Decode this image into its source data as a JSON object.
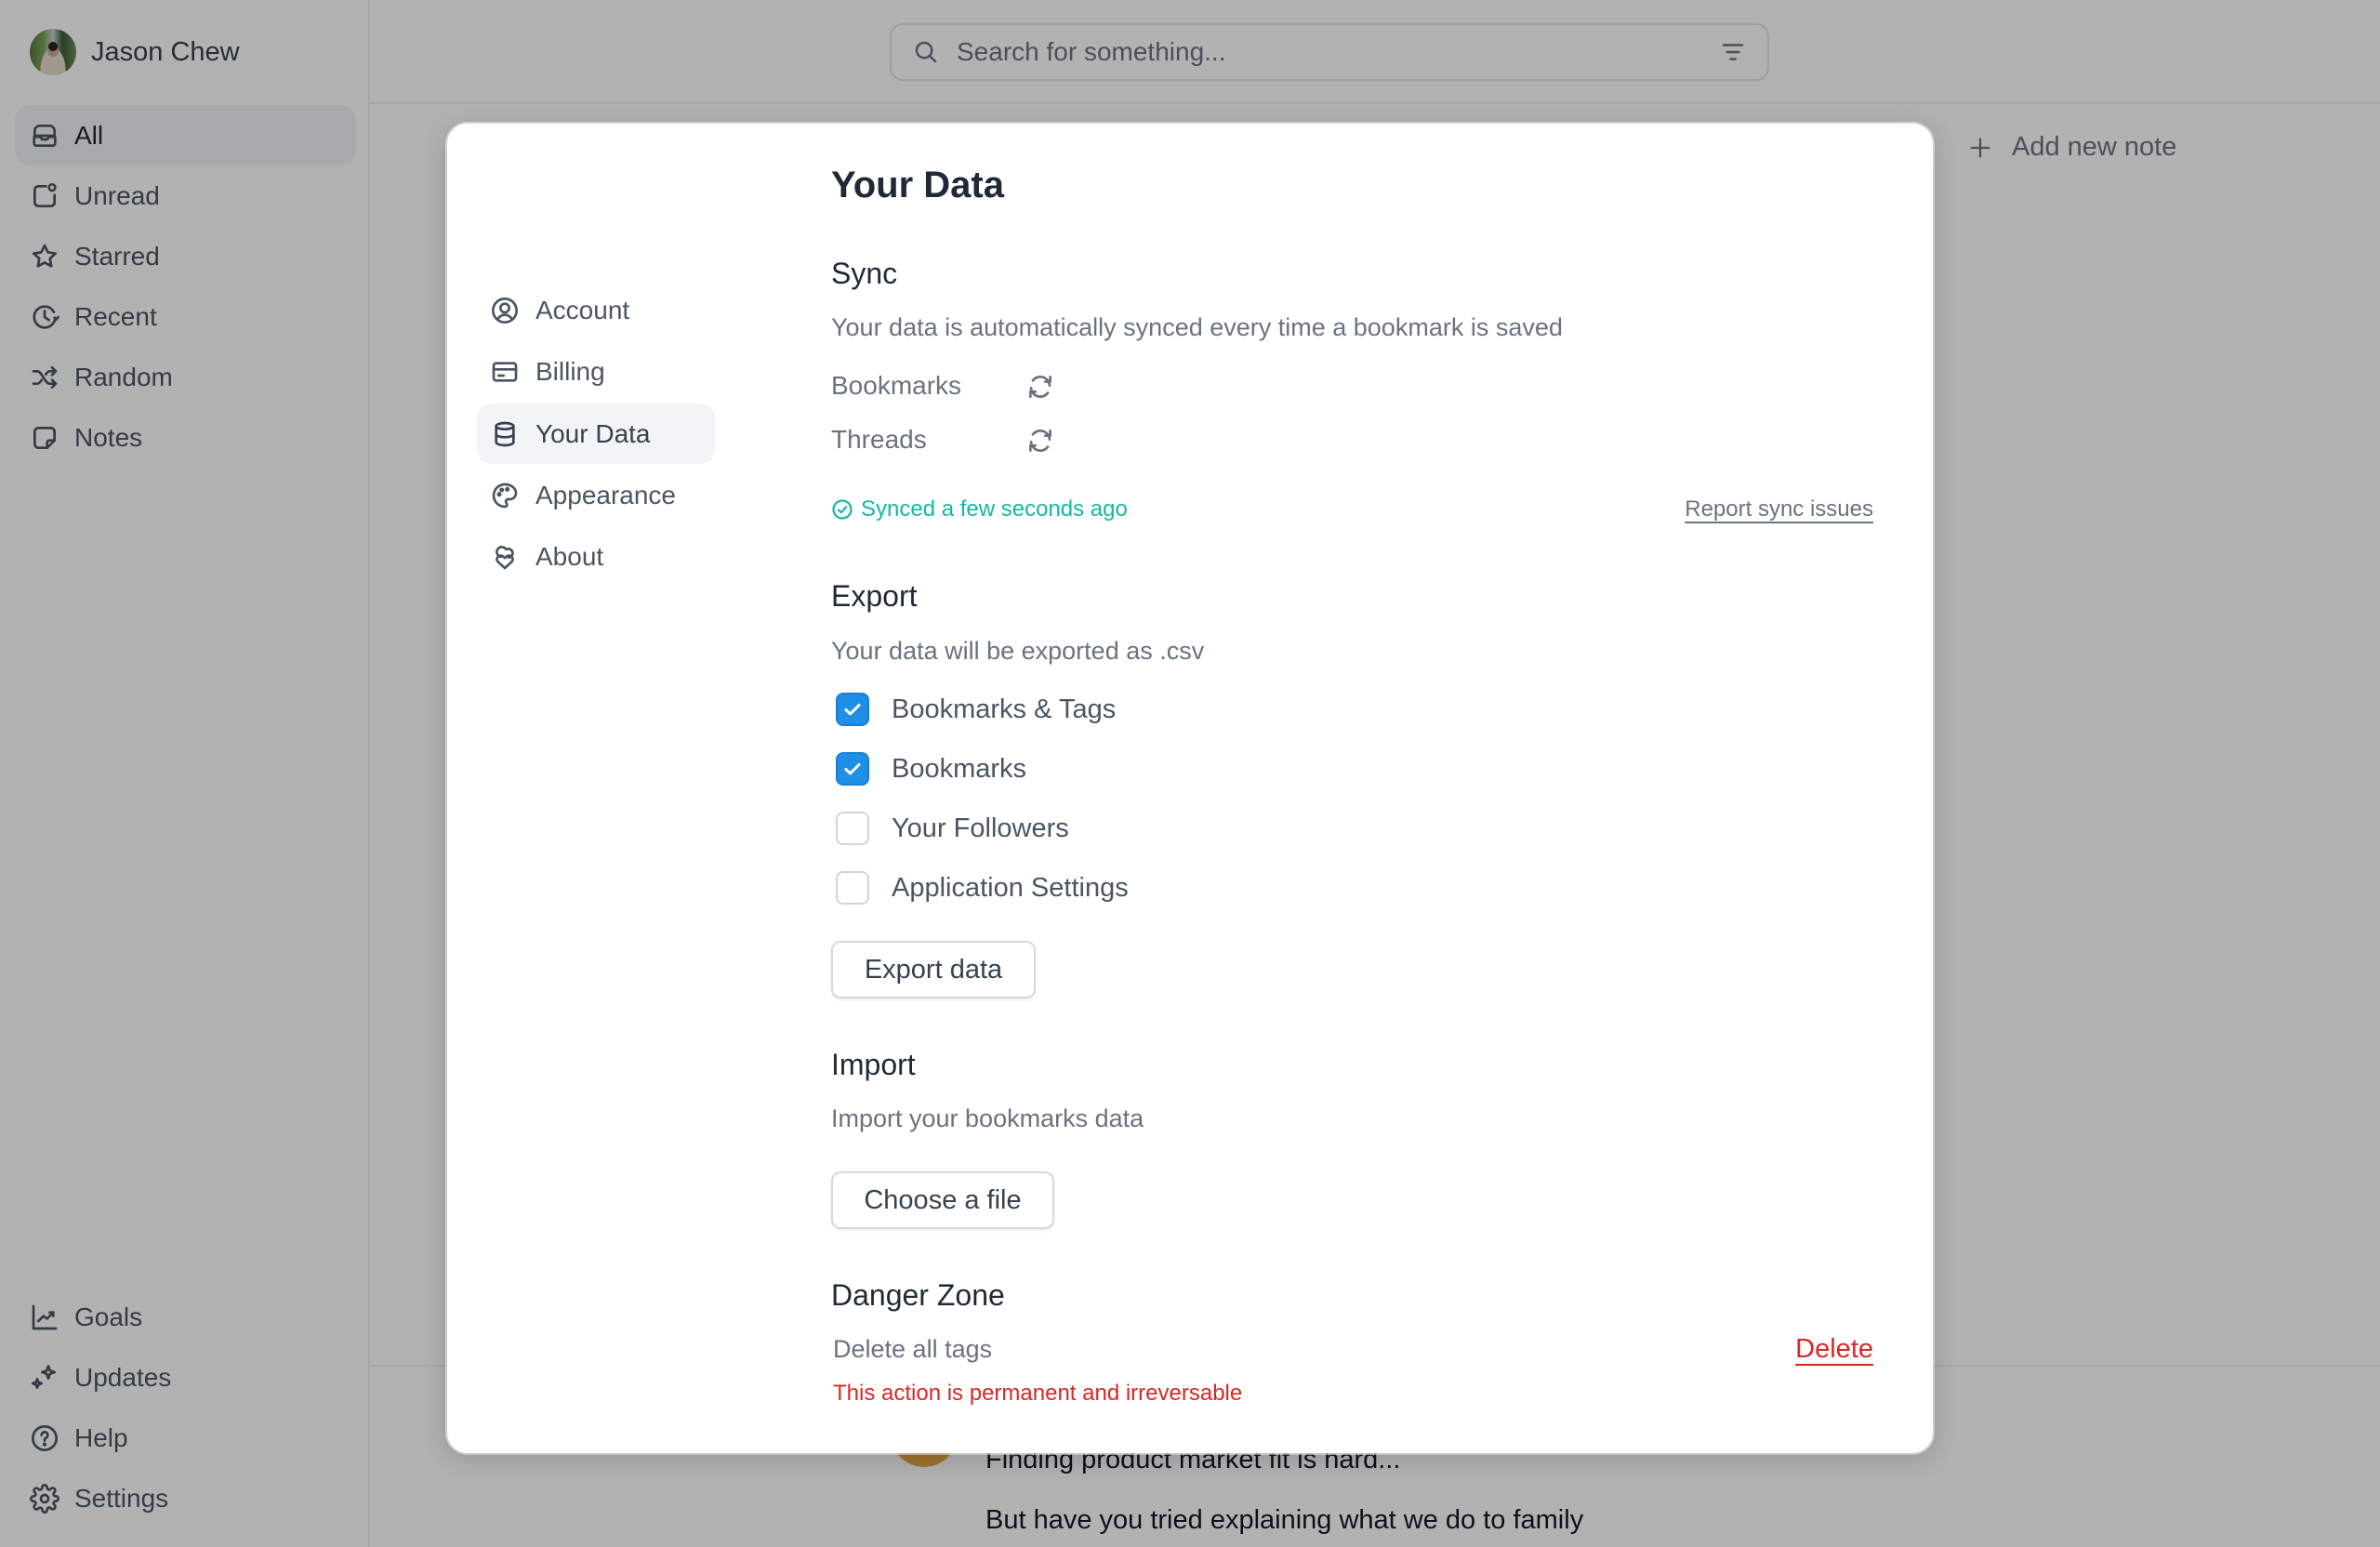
{
  "user": {
    "name": "Jason Chew",
    "avatar_icon": "user-avatar-photo"
  },
  "sidebar": {
    "top_items": [
      {
        "label": "All",
        "icon": "inbox-icon",
        "active": true
      },
      {
        "label": "Unread",
        "icon": "unread-icon",
        "active": false
      },
      {
        "label": "Starred",
        "icon": "star-icon",
        "active": false
      },
      {
        "label": "Recent",
        "icon": "history-icon",
        "active": false
      },
      {
        "label": "Random",
        "icon": "shuffle-icon",
        "active": false
      },
      {
        "label": "Notes",
        "icon": "sticky-note-icon",
        "active": false
      }
    ],
    "bottom_items": [
      {
        "label": "Goals",
        "icon": "chart-line-icon"
      },
      {
        "label": "Updates",
        "icon": "sparkles-icon"
      },
      {
        "label": "Help",
        "icon": "help-circle-icon"
      },
      {
        "label": "Settings",
        "icon": "gear-icon"
      }
    ]
  },
  "header": {
    "search_placeholder": "Search for something...",
    "search_value": "",
    "search_icon": "search-icon",
    "filter_icon": "filter-icon"
  },
  "main": {
    "add_note_label": "Add new note",
    "card_lines": [
      "Finding product market fit is hard...",
      "But have you tried explaining what we do to family"
    ]
  },
  "settings_modal": {
    "nav": [
      {
        "label": "Account",
        "icon": "user-circle-icon",
        "active": false
      },
      {
        "label": "Billing",
        "icon": "credit-card-icon",
        "active": false
      },
      {
        "label": "Your Data",
        "icon": "database-icon",
        "active": true
      },
      {
        "label": "Appearance",
        "icon": "palette-icon",
        "active": false
      },
      {
        "label": "About",
        "icon": "about-icon",
        "active": false
      }
    ],
    "title": "Your Data",
    "sync": {
      "heading": "Sync",
      "description": "Your data is automatically synced every time a bookmark is saved",
      "items": [
        {
          "label": "Bookmarks",
          "icon": "refresh-icon"
        },
        {
          "label": "Threads",
          "icon": "refresh-icon"
        }
      ],
      "status": "Synced a few seconds ago",
      "status_color": "#14b8a6",
      "report_link": "Report sync issues"
    },
    "export": {
      "heading": "Export",
      "description": "Your data will be exported as .csv",
      "options": [
        {
          "label": "Bookmarks & Tags",
          "checked": true
        },
        {
          "label": "Bookmarks",
          "checked": true
        },
        {
          "label": "Your Followers",
          "checked": false
        },
        {
          "label": "Application Settings",
          "checked": false
        }
      ],
      "button": "Export data",
      "checkbox_color": "#1f8ee6"
    },
    "import": {
      "heading": "Import",
      "description": "Import your bookmarks data",
      "button": "Choose a file"
    },
    "danger": {
      "heading": "Danger Zone",
      "item_label": "Delete all tags",
      "action": "Delete",
      "warning": "This action is permanent and irreversable",
      "color": "#dc2626"
    }
  }
}
